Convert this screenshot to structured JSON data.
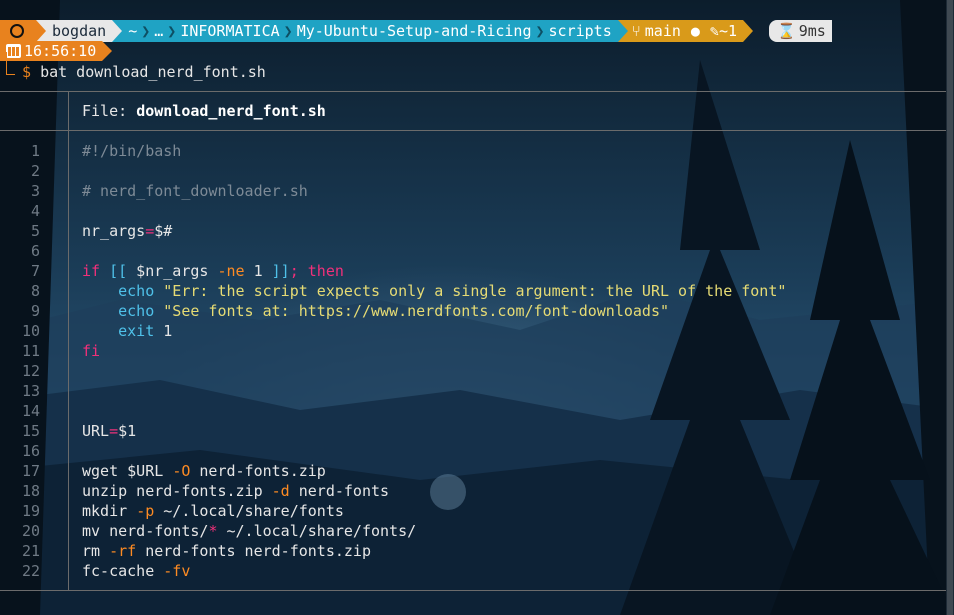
{
  "prompt": {
    "user": "bogdan",
    "path": [
      "~",
      "…",
      "INFORMATICA",
      "My-Ubuntu-Setup-and-Ricing",
      "scripts"
    ],
    "git_branch": "main",
    "git_dirty": "●",
    "git_changes": "~1",
    "exec_time": "9ms",
    "time": "16:56:10",
    "symbol": "$",
    "command": "bat download_nerd_font.sh"
  },
  "file": {
    "label": "File:",
    "name": "download_nerd_font.sh"
  },
  "code_lines": [
    {
      "n": "1",
      "html": "<span class='cmt'>#!/bin/bash</span>"
    },
    {
      "n": "2",
      "html": ""
    },
    {
      "n": "3",
      "html": "<span class='cmt'># nerd_font_downloader.sh</span>"
    },
    {
      "n": "4",
      "html": ""
    },
    {
      "n": "5",
      "html": "nr_args<span class='op'>=</span>$#"
    },
    {
      "n": "6",
      "html": ""
    },
    {
      "n": "7",
      "html": "<span class='kw'>if</span> <span class='bi'>[[</span> $nr_args <span class='fl'>-ne</span> 1 <span class='bi'>]]</span><span class='kw'>;</span> <span class='kw'>then</span>"
    },
    {
      "n": "8",
      "html": "    <span class='bi'>echo</span> <span class='str'>\"Err: the script expects only a single argument: the URL of the font\"</span>"
    },
    {
      "n": "9",
      "html": "    <span class='bi'>echo</span> <span class='str'>\"See fonts at: https://www.nerdfonts.com/font-downloads\"</span>"
    },
    {
      "n": "10",
      "html": "    <span class='bi'>exit</span> 1"
    },
    {
      "n": "11",
      "html": "<span class='kw'>fi</span>"
    },
    {
      "n": "12",
      "html": ""
    },
    {
      "n": "13",
      "html": ""
    },
    {
      "n": "14",
      "html": ""
    },
    {
      "n": "15",
      "html": "URL<span class='op'>=</span>$1"
    },
    {
      "n": "16",
      "html": ""
    },
    {
      "n": "17",
      "html": "wget $URL <span class='fl'>-O</span> nerd-fonts.zip"
    },
    {
      "n": "18",
      "html": "unzip nerd-fonts.zip <span class='fl'>-d</span> nerd-fonts"
    },
    {
      "n": "19",
      "html": "mkdir <span class='fl'>-p</span> ~/.local/share/fonts"
    },
    {
      "n": "20",
      "html": "mv nerd-fonts/<span class='op'>*</span> ~/.local/share/fonts/"
    },
    {
      "n": "21",
      "html": "rm <span class='fl'>-rf</span> nerd-fonts nerd-fonts.zip"
    },
    {
      "n": "22",
      "html": "fc-cache <span class='fl'>-fv</span>"
    }
  ],
  "colors": {
    "prompt_orange": "#e8821e",
    "prompt_cyan": "#1fa3c4",
    "prompt_gold": "#d99a1a",
    "keyword": "#f0307a",
    "flag": "#fd8b23",
    "builtin": "#4fc1e9",
    "string": "#e6db74",
    "comment": "#7d8a96"
  },
  "icons": [
    "ubuntu-logo-icon",
    "git-branch-icon",
    "edit-icon",
    "clock-icon",
    "calendar-icon"
  ]
}
